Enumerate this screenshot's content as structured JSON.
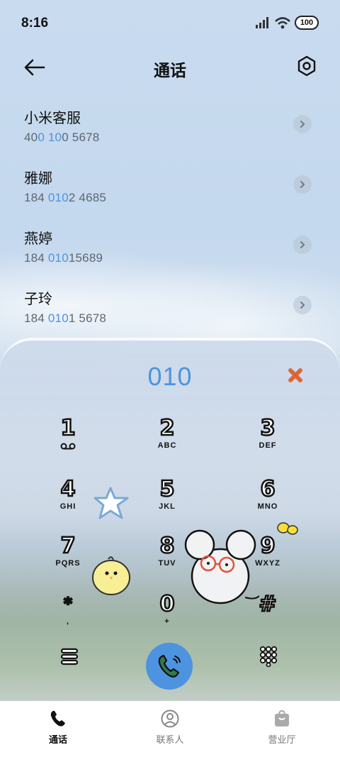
{
  "status": {
    "time": "8:16",
    "battery": "100"
  },
  "header": {
    "title": "通话"
  },
  "contacts": [
    {
      "name": "小米客服",
      "num_a": "40",
      "num_hl1": "0",
      "num_b": " ",
      "num_hl2": "10",
      "num_c": "0 5678"
    },
    {
      "name": "雅娜",
      "num_a": "184 ",
      "num_hl1": "010",
      "num_b": "",
      "num_hl2": "",
      "num_c": "2 4685"
    },
    {
      "name": "燕婷",
      "num_a": "184 ",
      "num_hl1": "010",
      "num_b": "",
      "num_hl2": "",
      "num_c": "15689"
    },
    {
      "name": "子玲",
      "num_a": "184 ",
      "num_hl1": "010",
      "num_b": "",
      "num_hl2": "",
      "num_c": "1 5678"
    }
  ],
  "dialer": {
    "input": "010",
    "keys": [
      {
        "digit": "1",
        "letters": "ꝏ"
      },
      {
        "digit": "2",
        "letters": "ABC"
      },
      {
        "digit": "3",
        "letters": "DEF"
      },
      {
        "digit": "4",
        "letters": "GHI"
      },
      {
        "digit": "5",
        "letters": "JKL"
      },
      {
        "digit": "6",
        "letters": "MNO"
      },
      {
        "digit": "7",
        "letters": "PQRS"
      },
      {
        "digit": "8",
        "letters": "TUV"
      },
      {
        "digit": "9",
        "letters": "WXYZ"
      },
      {
        "digit": "*",
        "letters": ","
      },
      {
        "digit": "0",
        "letters": "+"
      },
      {
        "digit": "#",
        "letters": ""
      }
    ]
  },
  "nav": [
    {
      "label": "通话",
      "icon": "phone-icon",
      "active": true
    },
    {
      "label": "联系人",
      "icon": "person-icon",
      "active": false
    },
    {
      "label": "营业厅",
      "icon": "bag-icon",
      "active": false
    }
  ],
  "colors": {
    "accent": "#4d93df",
    "clear": "#e06a3a"
  }
}
